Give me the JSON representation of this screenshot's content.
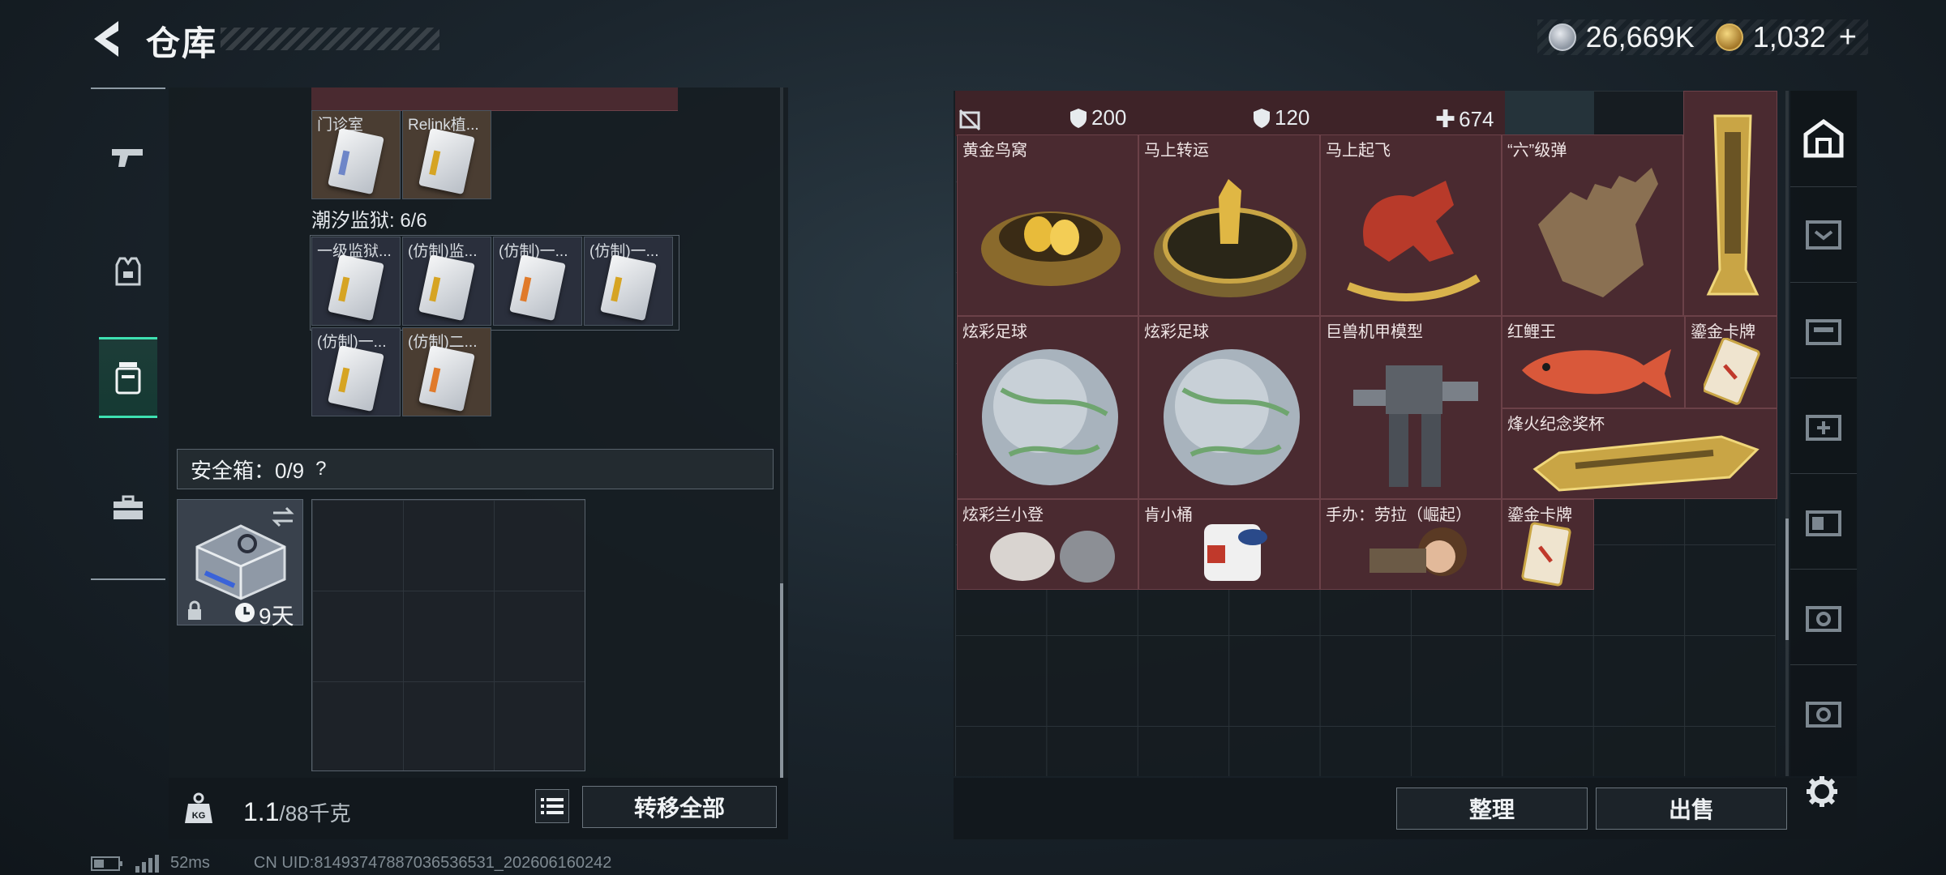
{
  "header": {
    "title": "仓库",
    "currency_silver": "26,669K",
    "currency_gold": "1,032",
    "currency_plus": "+"
  },
  "left_sidebar": {
    "tabs": [
      "weapons-icon",
      "backpack-icon",
      "locker-icon",
      "toolbox-icon"
    ],
    "active_index": 2
  },
  "left_panel": {
    "top_row_labels": [
      "门诊室",
      "Relink植..."
    ],
    "prison_label": "潮汐监狱: 6/6",
    "prison_items": [
      "一级监狱...",
      "(仿制)监...",
      "(仿制)一...",
      "(仿制)一...",
      "(仿制)一...",
      "(仿制)二..."
    ],
    "safebox_label": "安全箱：0/9",
    "safebox_help": "?",
    "safebox_days": "9天",
    "weight_value": "1.1",
    "weight_max": "/88千克",
    "transfer_all": "转移全部"
  },
  "right_panel": {
    "stats": [
      "200",
      "120",
      "674"
    ],
    "items": [
      {
        "label": "黄金鸟窝"
      },
      {
        "label": "马上转运"
      },
      {
        "label": "马上起飞"
      },
      {
        "label": "“六”级弹"
      },
      {
        "label": "炫彩足球"
      },
      {
        "label": "炫彩足球"
      },
      {
        "label": "巨兽机甲模型"
      },
      {
        "label": "红鲤王"
      },
      {
        "label": "鎏金卡牌"
      },
      {
        "label": "烽火纪念奖杯"
      },
      {
        "label": "炫彩兰小登"
      },
      {
        "label": "肯小桶"
      },
      {
        "label": "手办：劳拉（崛起）"
      },
      {
        "label": "鎏金卡牌"
      }
    ],
    "sort_button": "整理",
    "sell_button": "出售"
  },
  "status_bar": {
    "ping": "52ms",
    "uid": "CN UID:8149374788703653653​1_202606160242"
  },
  "colors": {
    "accent": "#3ee0b1",
    "item_bg": "#4a2a30"
  }
}
